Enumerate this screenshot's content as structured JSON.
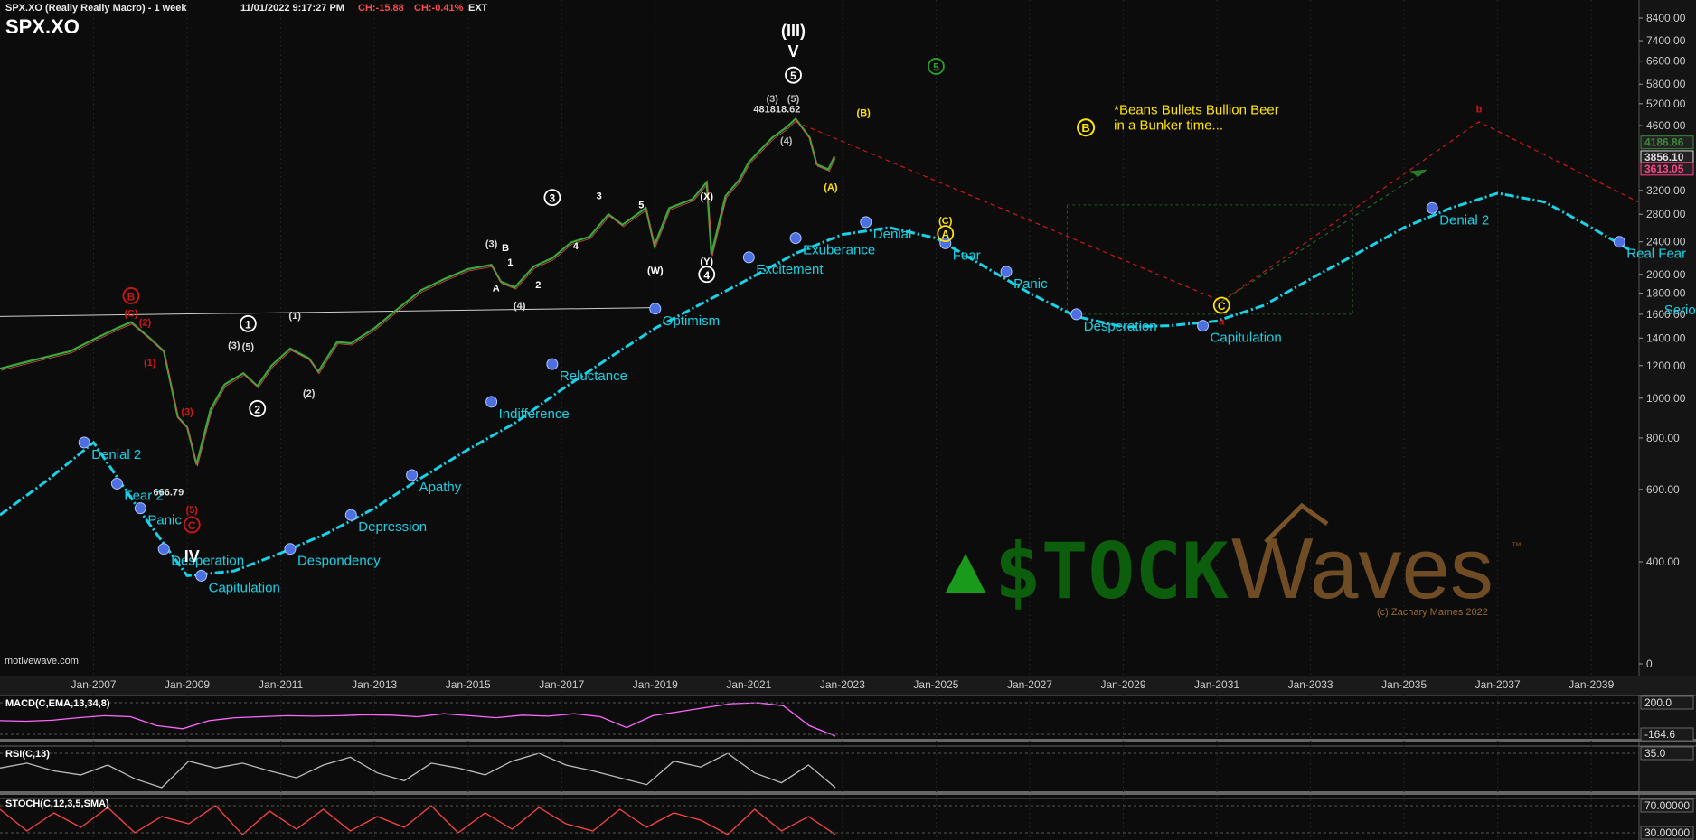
{
  "header": {
    "title": "SPX.XO (Really Really Macro) - 1 week",
    "datetime": "11/01/2022 9:17:27 PM",
    "change": "CH:-15.88",
    "change_pct": "CH:-0.41%",
    "session": "EXT",
    "symbol": "SPX.XO"
  },
  "footer": {
    "source": "motivewave.com"
  },
  "colors": {
    "background": "#0c0c0c",
    "sentiment_curve": "#19d2e6",
    "sentiment_dot": "#4e6fe0",
    "yellow": "#ffe400",
    "red": "#d01818",
    "green": "#2aa02a",
    "brown": "#7a5426",
    "macd": "#ff66ff",
    "rsi": "#bbbbbb",
    "stoch": "#ff4444"
  },
  "chart_data": {
    "type": "line",
    "y_scale": "log",
    "y_ticks": [
      "8400.00",
      "7400.00",
      "6600.00",
      "5800.00",
      "5200.00",
      "4600.00",
      "3200.00",
      "2800.00",
      "2400.00",
      "2000.00",
      "1800.00",
      "1600.00",
      "1400.00",
      "1200.00",
      "1000.00",
      "800.00",
      "600.00",
      "400.00",
      "0"
    ],
    "x_ticks": [
      "Jan-2007",
      "Jan-2009",
      "Jan-2011",
      "Jan-2013",
      "Jan-2015",
      "Jan-2017",
      "Jan-2019",
      "Jan-2021",
      "Jan-2023",
      "Jan-2025",
      "Jan-2027",
      "Jan-2029",
      "Jan-2031",
      "Jan-2033",
      "Jan-2035",
      "Jan-2037",
      "Jan-2039"
    ],
    "price_labels": [
      {
        "label": "4186.86",
        "color": "#3a8a3a",
        "y": 4186.86
      },
      {
        "label": "3856.10",
        "color": "#dddddd",
        "y": 3856.1
      },
      {
        "label": "3613.05",
        "color": "#ff4488",
        "y": 3613.05
      }
    ],
    "price_series": {
      "name": "SPX",
      "x": [
        2005.0,
        2005.5,
        2006.0,
        2006.5,
        2007.0,
        2007.5,
        2007.8,
        2008.2,
        2008.5,
        2008.8,
        2009.0,
        2009.2,
        2009.5,
        2009.8,
        2010.2,
        2010.5,
        2010.8,
        2011.2,
        2011.6,
        2011.8,
        2012.2,
        2012.5,
        2013.0,
        2013.5,
        2014.0,
        2014.5,
        2015.0,
        2015.5,
        2015.7,
        2016.0,
        2016.4,
        2016.8,
        2017.2,
        2017.6,
        2018.0,
        2018.3,
        2018.8,
        2018.98,
        2019.3,
        2019.8,
        2020.1,
        2020.2,
        2020.5,
        2020.8,
        2021.0,
        2021.5,
        2021.8,
        2022.0,
        2022.3,
        2022.45,
        2022.7,
        2022.83
      ],
      "y": [
        1180,
        1220,
        1260,
        1300,
        1390,
        1480,
        1530,
        1400,
        1300,
        900,
        850,
        690,
        940,
        1080,
        1150,
        1070,
        1200,
        1320,
        1250,
        1160,
        1370,
        1360,
        1480,
        1650,
        1830,
        1950,
        2060,
        2110,
        1920,
        1860,
        2090,
        2190,
        2390,
        2470,
        2800,
        2640,
        2900,
        2350,
        2900,
        3050,
        3350,
        2240,
        3100,
        3400,
        3750,
        4300,
        4550,
        4780,
        4300,
        3700,
        3600,
        3871
      ]
    },
    "sentiment_series": {
      "name": "",
      "x": [
        2005.0,
        2006.0,
        2007.0,
        2008.0,
        2009.0,
        2010.0,
        2011.0,
        2012.0,
        2013.0,
        2014.0,
        2015.0,
        2016.0,
        2017.0,
        2018.0,
        2019.0,
        2020.0,
        2021.0,
        2022.0,
        2023.0,
        2024.0,
        2025.0,
        2026.0,
        2027.0,
        2028.0,
        2029.0,
        2030.0,
        2031.0,
        2032.0,
        2033.0,
        2034.0,
        2035.0,
        2036.0,
        2037.0,
        2038.0,
        2039.0,
        2039.8
      ],
      "y": [
        520,
        630,
        780,
        530,
        370,
        380,
        420,
        470,
        540,
        640,
        750,
        870,
        1050,
        1250,
        1480,
        1700,
        1950,
        2250,
        2500,
        2600,
        2450,
        2100,
        1800,
        1580,
        1490,
        1500,
        1540,
        1680,
        1950,
        2250,
        2600,
        2900,
        3150,
        3000,
        2600,
        2300
      ],
      "phases": [
        {
          "label": "Denial 2",
          "x": 2006.8,
          "y": 780
        },
        {
          "label": "Fear 2",
          "x": 2007.5,
          "y": 620
        },
        {
          "label": "Panic",
          "x": 2008.0,
          "y": 540
        },
        {
          "label": "Desperation",
          "x": 2008.5,
          "y": 430
        },
        {
          "label": "Capitulation",
          "x": 2009.3,
          "y": 370
        },
        {
          "label": "Despondency",
          "x": 2011.2,
          "y": 430
        },
        {
          "label": "Depression",
          "x": 2012.5,
          "y": 520
        },
        {
          "label": "Apathy",
          "x": 2013.8,
          "y": 650
        },
        {
          "label": "Indifference",
          "x": 2015.5,
          "y": 980
        },
        {
          "label": "Reluctance",
          "x": 2016.8,
          "y": 1210
        },
        {
          "label": "Optimism",
          "x": 2019.0,
          "y": 1650
        },
        {
          "label": "Excitement",
          "x": 2021.0,
          "y": 2200
        },
        {
          "label": "Exuberance",
          "x": 2022.0,
          "y": 2450
        },
        {
          "label": "Denial",
          "x": 2023.5,
          "y": 2680
        },
        {
          "label": "Fear",
          "x": 2025.2,
          "y": 2380
        },
        {
          "label": "Panic",
          "x": 2026.5,
          "y": 2030
        },
        {
          "label": "Desperation",
          "x": 2028.0,
          "y": 1600
        },
        {
          "label": "Capitulation",
          "x": 2030.7,
          "y": 1500
        },
        {
          "label": "Denial 2",
          "x": 2035.6,
          "y": 2900
        },
        {
          "label": "Real Fear",
          "x": 2039.6,
          "y": 2400
        },
        {
          "label": "Serious F",
          "x": 2040.4,
          "y": 1750
        }
      ]
    },
    "wave_labels": [
      {
        "text": "(III)",
        "x": 2021.95,
        "y": 7600,
        "color": "#ffffff"
      },
      {
        "text": "V",
        "x": 2021.95,
        "y": 6750,
        "color": "#ffffff"
      },
      {
        "text": "5",
        "x": 2021.95,
        "y": 5950,
        "color": "#ffffff",
        "circle": true
      },
      {
        "text": "481818.62",
        "x": 2021.6,
        "y": 4950,
        "color": "#dddddd"
      },
      {
        "text": "(3)",
        "x": 2021.5,
        "y": 5250,
        "color": "#bbbbbb"
      },
      {
        "text": "(5)",
        "x": 2021.95,
        "y": 5250,
        "color": "#bbbbbb"
      },
      {
        "text": "(4)",
        "x": 2021.8,
        "y": 4150,
        "color": "#bbbbbb"
      },
      {
        "text": "(B)",
        "x": 2023.45,
        "y": 4850,
        "color": "#ffe400"
      },
      {
        "text": "(A)",
        "x": 2022.75,
        "y": 3200,
        "color": "#ffe400"
      },
      {
        "text": "5",
        "x": 2025.0,
        "y": 6250,
        "color": "#2aa02a",
        "circle": true
      },
      {
        "text": "(C)",
        "x": 2025.2,
        "y": 2650,
        "color": "#ffe400"
      },
      {
        "text": "A",
        "x": 2025.2,
        "y": 2450,
        "color": "#ffe400",
        "circle": true
      },
      {
        "text": "C",
        "x": 2031.1,
        "y": 1640,
        "color": "#ffe400",
        "circle": true
      },
      {
        "text": "a",
        "x": 2031.1,
        "y": 1510,
        "color": "#d01818"
      },
      {
        "text": "b",
        "x": 2036.6,
        "y": 4950,
        "color": "#d01818"
      },
      {
        "text": "B",
        "x": 2007.8,
        "y": 1730,
        "color": "#d01818",
        "circle": true
      },
      {
        "text": "(C)",
        "x": 2007.8,
        "y": 1580,
        "color": "#d01818"
      },
      {
        "text": "(2)",
        "x": 2008.1,
        "y": 1500,
        "color": "#d01818"
      },
      {
        "text": "(1)",
        "x": 2008.2,
        "y": 1200,
        "color": "#d01818"
      },
      {
        "text": "(3)",
        "x": 2009.0,
        "y": 910,
        "color": "#d01818"
      },
      {
        "text": "(5)",
        "x": 2009.1,
        "y": 525,
        "color": "#d01818"
      },
      {
        "text": "C",
        "x": 2009.1,
        "y": 480,
        "color": "#d01818",
        "circle": true
      },
      {
        "text": "IV",
        "x": 2009.1,
        "y": 400,
        "color": "#ffffff"
      },
      {
        "text": "666.79",
        "x": 2008.6,
        "y": 580,
        "color": "#dddddd"
      },
      {
        "text": "1",
        "x": 2010.3,
        "y": 1480,
        "color": "#ffffff",
        "circle": true
      },
      {
        "text": "2",
        "x": 2010.5,
        "y": 920,
        "color": "#ffffff",
        "circle": true
      },
      {
        "text": "(3)",
        "x": 2010.0,
        "y": 1320,
        "color": "#dddddd"
      },
      {
        "text": "(5)",
        "x": 2010.3,
        "y": 1310,
        "color": "#dddddd"
      },
      {
        "text": "(1)",
        "x": 2011.3,
        "y": 1560,
        "color": "#dddddd"
      },
      {
        "text": "(2)",
        "x": 2011.6,
        "y": 1010,
        "color": "#dddddd"
      },
      {
        "text": "3",
        "x": 2016.8,
        "y": 3000,
        "color": "#ffffff",
        "circle": true
      },
      {
        "text": "(3)",
        "x": 2015.5,
        "y": 2330,
        "color": "#dddddd"
      },
      {
        "text": "(4)",
        "x": 2016.1,
        "y": 1650,
        "color": "#dddddd"
      },
      {
        "text": "B",
        "x": 2015.8,
        "y": 2280,
        "color": "#ffffff"
      },
      {
        "text": "A",
        "x": 2015.6,
        "y": 1820,
        "color": "#ffffff"
      },
      {
        "text": "(X)",
        "x": 2020.1,
        "y": 3040,
        "color": "#ffffff"
      },
      {
        "text": "(W)",
        "x": 2019.0,
        "y": 2010,
        "color": "#ffffff"
      },
      {
        "text": "(Y)",
        "x": 2020.1,
        "y": 2110,
        "color": "#ffffff"
      },
      {
        "text": "4",
        "x": 2020.1,
        "y": 1950,
        "color": "#ffffff",
        "circle": true
      },
      {
        "text": "3",
        "x": 2017.8,
        "y": 3050,
        "color": "#ffffff"
      },
      {
        "text": "5",
        "x": 2018.7,
        "y": 2900,
        "color": "#ffffff"
      },
      {
        "text": "1",
        "x": 2015.9,
        "y": 2100,
        "color": "#ffffff"
      },
      {
        "text": "2",
        "x": 2016.5,
        "y": 1850,
        "color": "#ffffff"
      },
      {
        "text": "4",
        "x": 2017.3,
        "y": 2300,
        "color": "#ffffff"
      }
    ],
    "annotation": {
      "line1": "*Beans Bullets Bullion Beer",
      "line2": "in a Bunker time...",
      "badge": "B",
      "color": "#ffe400"
    },
    "watermark": {
      "text_left": "$TOCK",
      "text_right": "Waves",
      "tm": "™",
      "copyright": "(c) Zachary Marnes 2022",
      "green": "#1a9a1a",
      "brown": "#7a5426"
    },
    "indicators": [
      {
        "name": "MACD(C,EMA,13,34,8)",
        "ticks": [
          "200.0",
          "-164.6"
        ],
        "values": [
          -10,
          -15,
          -5,
          20,
          40,
          30,
          -60,
          -90,
          -10,
          20,
          30,
          40,
          35,
          40,
          50,
          45,
          30,
          60,
          40,
          20,
          45,
          35,
          60,
          30,
          -80,
          40,
          80,
          120,
          160,
          170,
          140,
          -60,
          -164.6
        ]
      },
      {
        "name": "RSI(C,13)",
        "ticks": [
          "35.0"
        ],
        "values": [
          55,
          60,
          52,
          48,
          58,
          44,
          35,
          62,
          55,
          60,
          52,
          45,
          58,
          66,
          50,
          42,
          60,
          55,
          48,
          62,
          70,
          58,
          52,
          45,
          38,
          62,
          56,
          70,
          50,
          40,
          58,
          35
        ]
      },
      {
        "name": "STOCH(C,12,3,5,SMA)",
        "ticks": [
          "70.00000",
          "30.00000"
        ],
        "values": [
          80,
          20,
          70,
          30,
          85,
          15,
          60,
          40,
          90,
          10,
          75,
          25,
          80,
          20,
          60,
          30,
          90,
          15,
          70,
          25,
          85,
          40,
          20,
          80,
          30,
          70,
          50,
          10,
          80,
          20,
          60,
          10
        ]
      }
    ]
  }
}
